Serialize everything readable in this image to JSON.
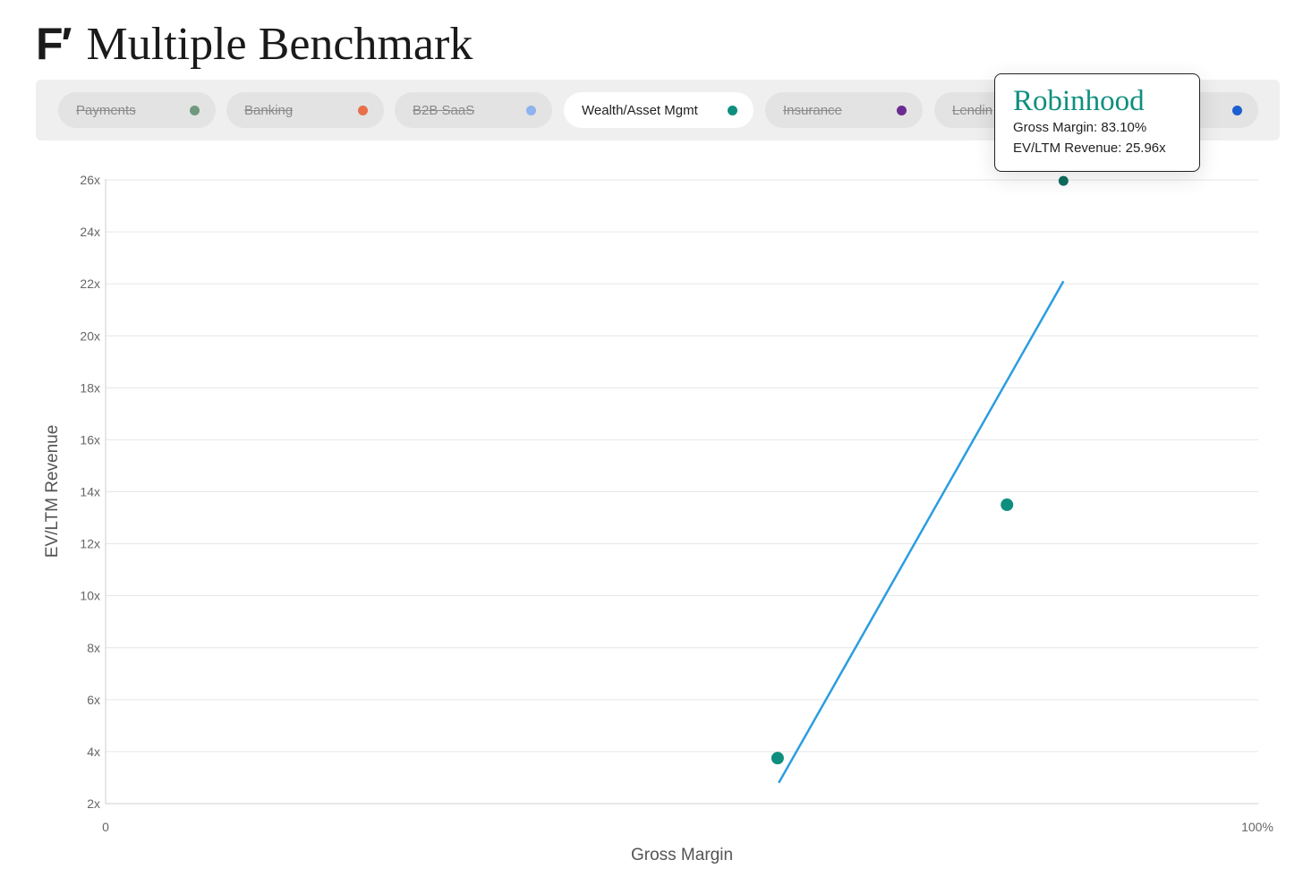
{
  "header": {
    "logo": "F′",
    "title": "Multiple Benchmark"
  },
  "filters": [
    {
      "label": "Payments",
      "color": "#6f9a7e",
      "active": false
    },
    {
      "label": "Banking",
      "color": "#e76f4a",
      "active": false
    },
    {
      "label": "B2B SaaS",
      "color": "#8fb3ee",
      "active": false
    },
    {
      "label": "Wealth/Asset Mgmt",
      "color": "#0e8f7e",
      "active": true
    },
    {
      "label": "Insurance",
      "color": "#6a2c91",
      "active": false
    },
    {
      "label": "Lendin",
      "color": "#1b5fd1",
      "active": false
    }
  ],
  "tooltip": {
    "name": "Robinhood",
    "gross_margin_line": "Gross Margin: 83.10%",
    "ev_line": "EV/LTM Revenue: 25.96x"
  },
  "chart_data": {
    "type": "scatter",
    "xlabel": "Gross Margin",
    "ylabel": "EV/LTM Revenue",
    "xlim": [
      0,
      100
    ],
    "ylim": [
      2,
      26
    ],
    "x_tick_labels": [
      "0",
      "100%"
    ],
    "y_ticks": [
      2,
      4,
      6,
      8,
      10,
      12,
      14,
      16,
      18,
      20,
      22,
      24,
      26
    ],
    "y_tick_labels": [
      "2x",
      "4x",
      "6x",
      "8x",
      "10x",
      "12x",
      "14x",
      "16x",
      "18x",
      "20x",
      "22x",
      "24x",
      "26x"
    ],
    "grid": true,
    "points": [
      {
        "x": 58.3,
        "y": 3.75,
        "color": "#0e8f7e"
      },
      {
        "x": 78.2,
        "y": 13.5,
        "color": "#0e8f7e"
      },
      {
        "x": 83.1,
        "y": 25.96,
        "color": "#0e6e5f"
      }
    ],
    "trendline": {
      "color": "#2a9de0",
      "x": [
        58.4,
        83.1
      ],
      "y": [
        2.8,
        22.1
      ]
    }
  }
}
